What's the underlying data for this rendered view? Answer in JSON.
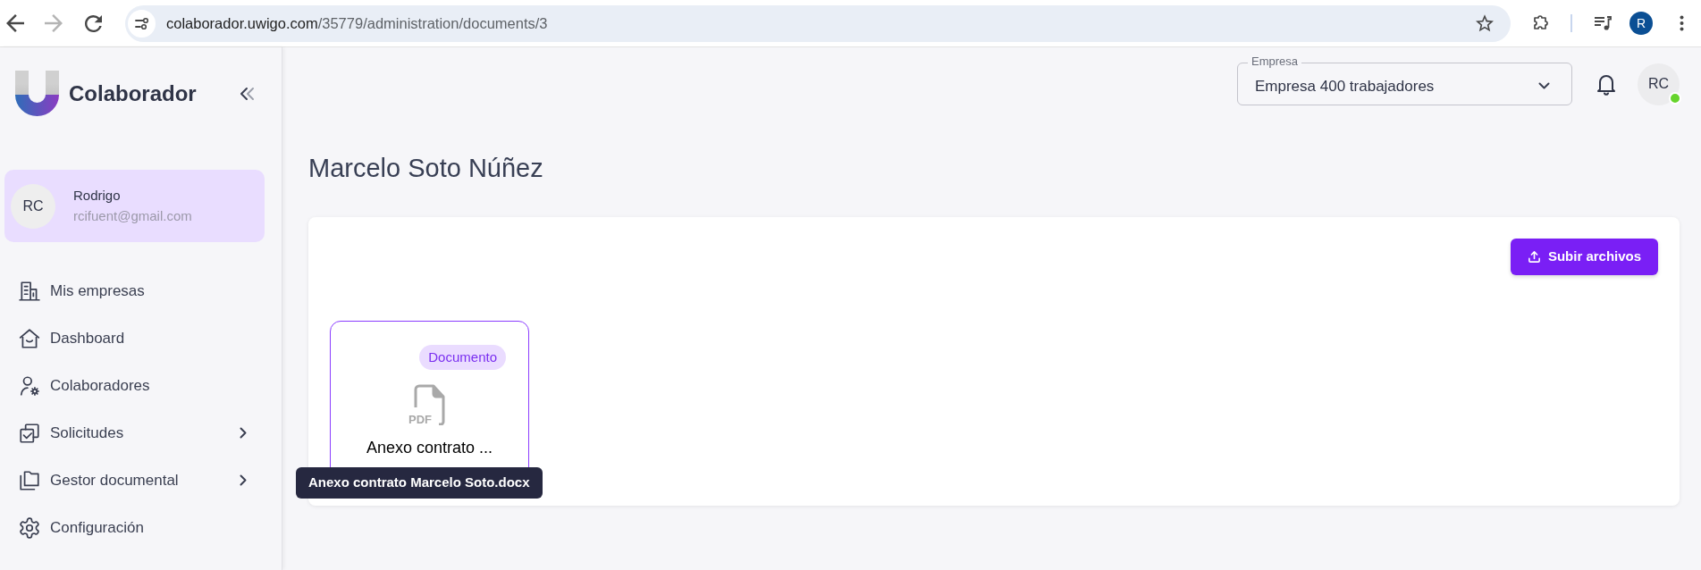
{
  "browser": {
    "back_enabled": true,
    "forward_enabled": false,
    "url_host": "colaborador.uwigo.com",
    "url_path": "/35779/administration/documents/3",
    "profile_initial": "R"
  },
  "sidebar": {
    "brand": "Colaborador",
    "user": {
      "initials": "RC",
      "name": "Rodrigo",
      "email": "rcifuent@gmail.com"
    },
    "items": [
      {
        "label": "Mis empresas",
        "selected": false,
        "expandable": false
      },
      {
        "label": "Dashboard",
        "selected": false,
        "expandable": false
      },
      {
        "label": "Colaboradores",
        "selected": false,
        "expandable": false
      },
      {
        "label": "Solicitudes",
        "selected": false,
        "expandable": true
      },
      {
        "label": "Gestor documental",
        "selected": false,
        "expandable": true
      },
      {
        "label": "Configuración",
        "selected": false,
        "expandable": false
      }
    ]
  },
  "header": {
    "company_select": {
      "label": "Empresa",
      "value": "Empresa 400 trabajadores"
    },
    "avatar": {
      "initials": "RC",
      "online": true
    }
  },
  "page": {
    "title": "Marcelo Soto Núñez",
    "upload_button": "Subir archivos",
    "files": [
      {
        "badge": "Documento",
        "type_label": "PDF",
        "name": "Anexo contrato ...",
        "tooltip": "Anexo contrato Marcelo Soto.docx",
        "selected": true
      }
    ]
  }
}
